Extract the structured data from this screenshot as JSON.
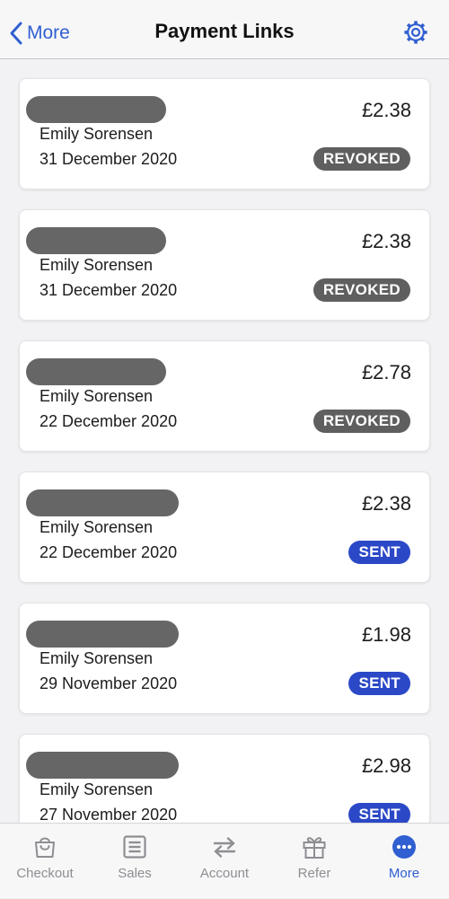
{
  "header": {
    "back_label": "More",
    "title": "Payment Links"
  },
  "payment_links": [
    {
      "amount": "£2.38",
      "customer": "Emily Sorensen",
      "date": "31 December 2020",
      "status": "REVOKED"
    },
    {
      "amount": "£2.38",
      "customer": "Emily Sorensen",
      "date": "31 December 2020",
      "status": "REVOKED"
    },
    {
      "amount": "£2.78",
      "customer": "Emily Sorensen",
      "date": "22 December 2020",
      "status": "REVOKED"
    },
    {
      "amount": "£2.38",
      "customer": "Emily Sorensen",
      "date": "22 December 2020",
      "status": "SENT"
    },
    {
      "amount": "£1.98",
      "customer": "Emily Sorensen",
      "date": "29 November 2020",
      "status": "SENT"
    },
    {
      "amount": "£2.98",
      "customer": "Emily Sorensen",
      "date": "27 November 2020",
      "status": "SENT"
    }
  ],
  "tabs": [
    {
      "label": "Checkout",
      "icon": "bag-icon",
      "active": false
    },
    {
      "label": "Sales",
      "icon": "list-icon",
      "active": false
    },
    {
      "label": "Account",
      "icon": "transfer-icon",
      "active": false
    },
    {
      "label": "Refer",
      "icon": "gift-icon",
      "active": false
    },
    {
      "label": "More",
      "icon": "more-icon",
      "active": true
    }
  ],
  "colors": {
    "accent": "#2f5fd0",
    "revoked": "#5f5f5f",
    "sent": "#2b48c7",
    "tab_inactive": "#8e8e93",
    "redaction": "#666666"
  }
}
